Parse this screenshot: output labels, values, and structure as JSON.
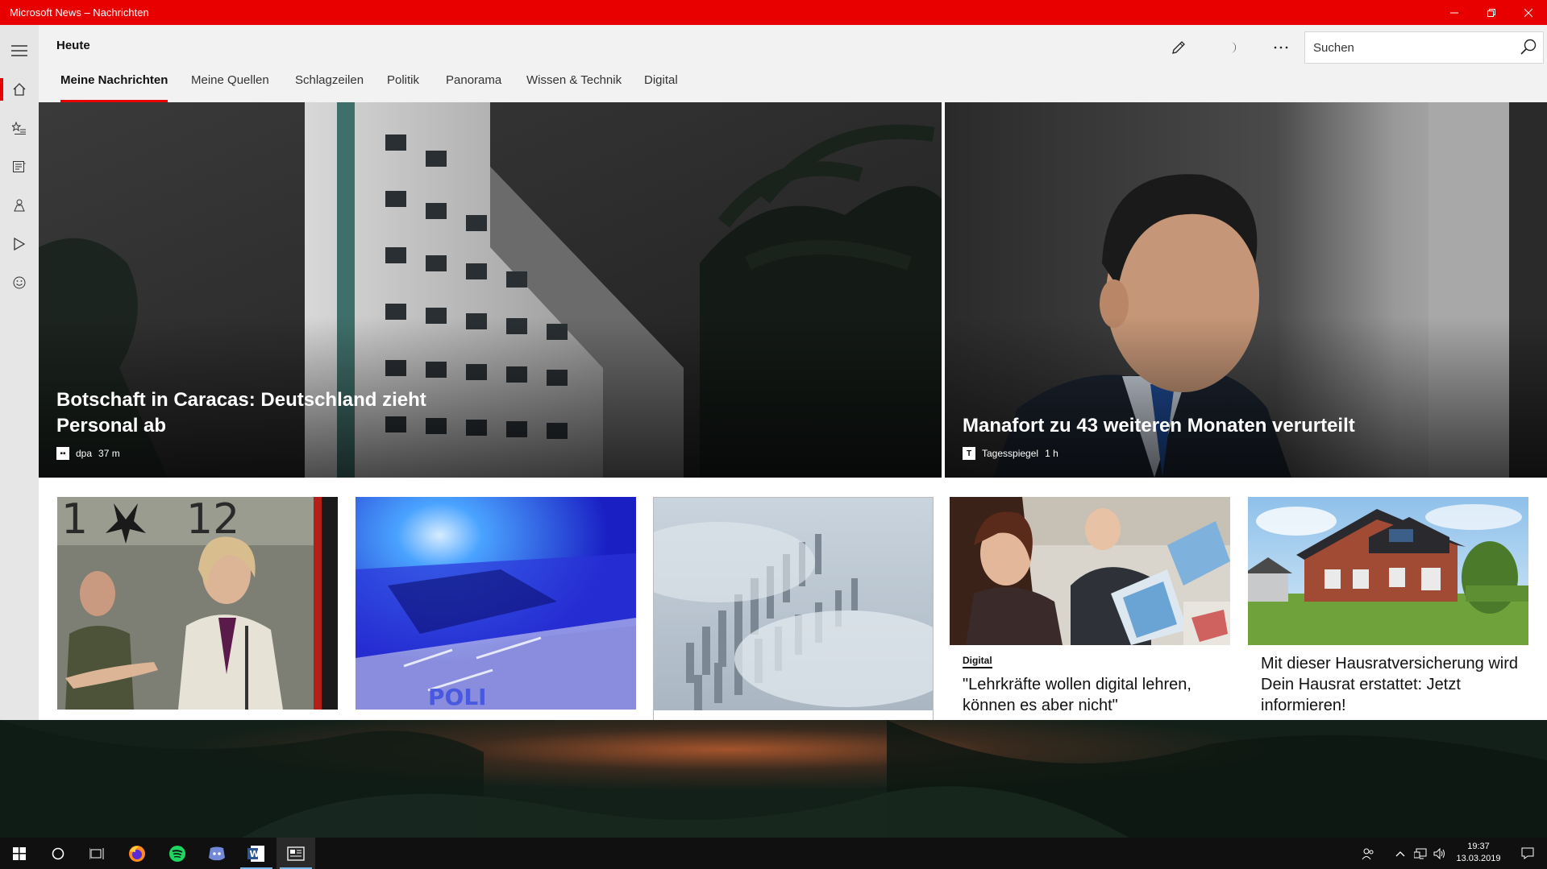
{
  "window": {
    "title": "Microsoft News – Nachrichten",
    "minimize_icon": "minimize-icon",
    "maximize_icon": "restore-icon",
    "close_icon": "close-icon"
  },
  "nav_rail": {
    "items": [
      {
        "icon": "hamburger-icon"
      },
      {
        "icon": "home-icon",
        "active": true
      },
      {
        "icon": "star-list-icon"
      },
      {
        "icon": "newspaper-icon"
      },
      {
        "icon": "people-icon"
      },
      {
        "icon": "play-icon"
      },
      {
        "icon": "smiley-icon"
      }
    ]
  },
  "header": {
    "title": "Heute",
    "edit_icon": "pencil-icon",
    "theme_icon": "moon-icon",
    "more_icon": "more-icon",
    "search": {
      "placeholder": "Suchen",
      "icon": "search-icon"
    }
  },
  "tabs": [
    {
      "label": "Meine Nachrichten",
      "active": true
    },
    {
      "label": "Meine Quellen"
    },
    {
      "label": "Schlagzeilen"
    },
    {
      "label": "Politik"
    },
    {
      "label": "Panorama"
    },
    {
      "label": "Wissen & Technik"
    },
    {
      "label": "Digital"
    }
  ],
  "hero": [
    {
      "title": "Botschaft in Caracas: Deutschland zieht Personal ab",
      "source": "dpa",
      "time": "37 m"
    },
    {
      "title": "Manafort zu 43 weiteren Monaten verurteilt",
      "source": "Tagesspiegel",
      "source_logo": "T",
      "time": "1 h"
    }
  ],
  "cards": [
    {
      "image": "politician-at-podium-photo"
    },
    {
      "image": "police-car-photo"
    },
    {
      "image": "city-fog-aerial-photo"
    },
    {
      "image": "students-tablets-photo",
      "tag": "Digital",
      "text": "\"Lehrkräfte wollen digital lehren, können es aber nicht\""
    },
    {
      "image": "house-photo",
      "text": "Mit dieser Hausratversicherung wird Dein Hausrat erstattet: Jetzt informieren!"
    }
  ],
  "taskbar": {
    "apps": [
      "windows-start-icon",
      "cortana-icon",
      "task-view-icon",
      "firefox-icon",
      "spotify-icon",
      "discord-icon",
      "word-icon",
      "news-app-icon"
    ],
    "tray": [
      "people-icon",
      "chevron-up-icon",
      "network-icon",
      "volume-icon"
    ],
    "time": "19:37",
    "date": "13.03.2019",
    "notification_icon": "action-center-icon"
  },
  "colors": {
    "accent": "#e80000",
    "rail_bg": "#e6e6e6",
    "header_bg": "#f2f2f2"
  }
}
